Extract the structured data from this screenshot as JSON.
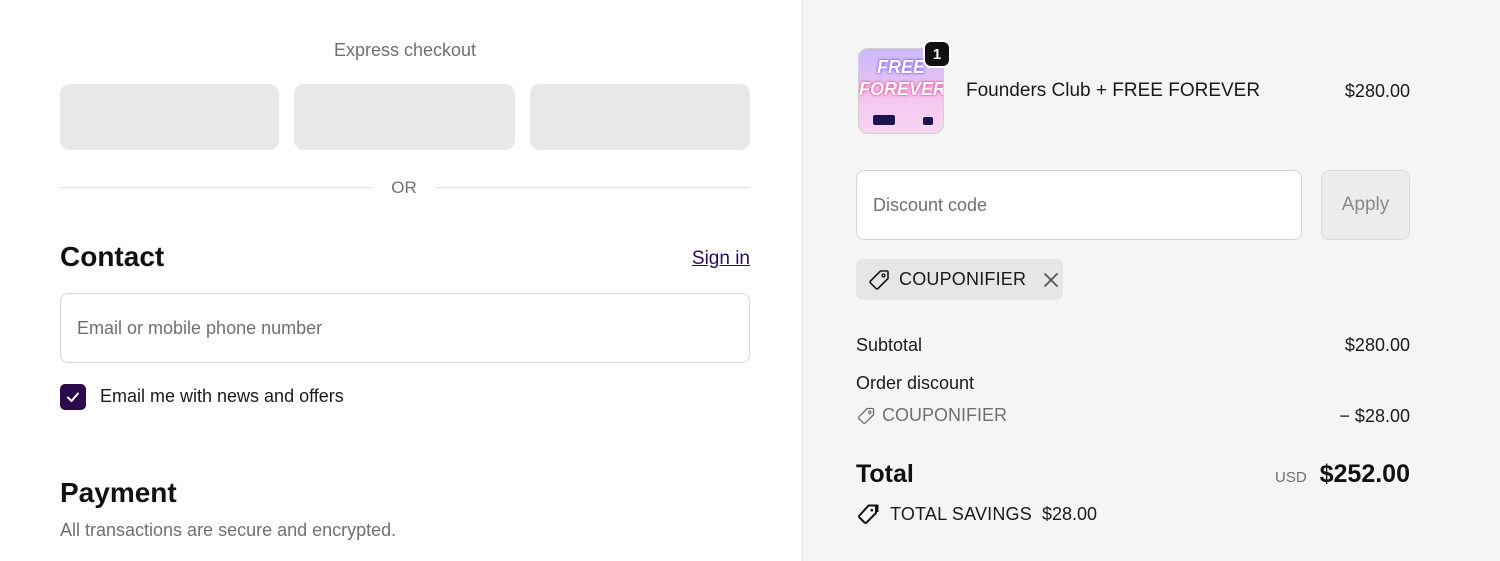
{
  "express_checkout": {
    "title": "Express checkout",
    "divider_text": "OR"
  },
  "contact": {
    "heading": "Contact",
    "sign_in": "Sign in",
    "email_placeholder": "Email or mobile phone number",
    "newsletter_label": "Email me with news and offers",
    "newsletter_checked": true
  },
  "payment": {
    "heading": "Payment",
    "subtitle": "All transactions are secure and encrypted."
  },
  "order": {
    "item": {
      "name": "Founders Club + FREE FOREVER",
      "price": "$280.00",
      "quantity": "1",
      "thumbnail_line1": "FREE",
      "thumbnail_line2": "FOREVER"
    },
    "discount_placeholder": "Discount code",
    "apply_label": "Apply",
    "applied_coupon": "COUPONIFIER",
    "subtotal_label": "Subtotal",
    "subtotal_value": "$280.00",
    "discount_label": "Order discount",
    "discount_code": "COUPONIFIER",
    "discount_value": "− $28.00",
    "total_label": "Total",
    "currency": "USD",
    "total_value": "$252.00",
    "savings_label": "TOTAL SAVINGS",
    "savings_value": "$28.00"
  },
  "colors": {
    "accent": "#2a0a4a",
    "sidebar_bg": "#f5f5f5"
  }
}
